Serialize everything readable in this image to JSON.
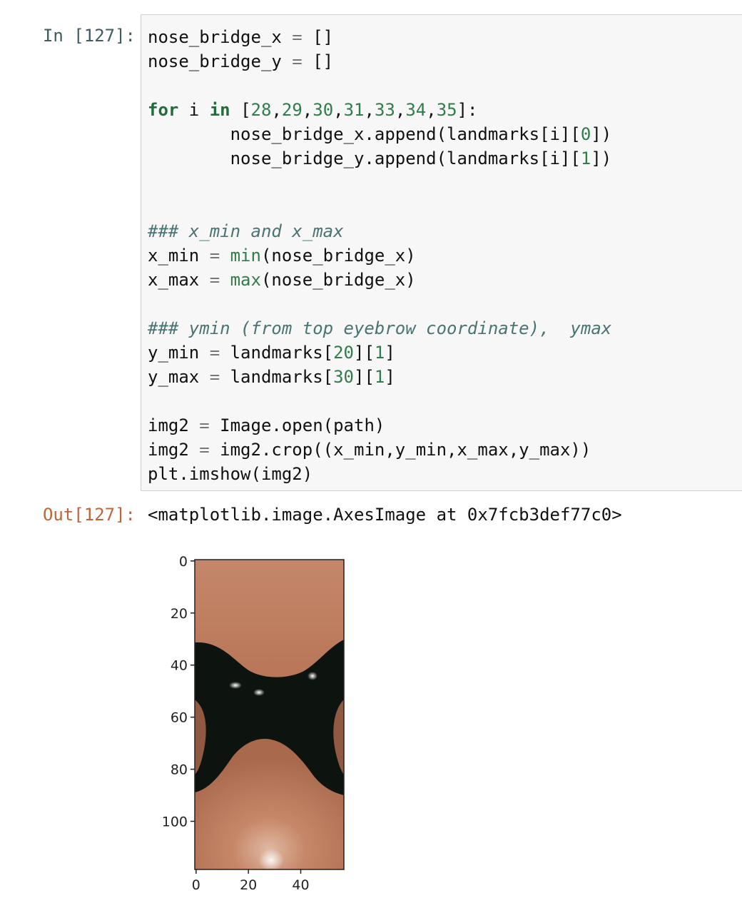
{
  "cell": {
    "in_prompt": "In [127]:",
    "out_prompt": "Out[127]:",
    "code_lines": [
      [
        [
          "nose_bridge_x ",
          ""
        ],
        [
          "=",
          "op"
        ],
        [
          " []",
          ""
        ]
      ],
      [
        [
          "nose_bridge_y ",
          ""
        ],
        [
          "=",
          "op"
        ],
        [
          " []",
          ""
        ]
      ],
      [],
      [
        [
          "for",
          "kw"
        ],
        [
          " i ",
          ""
        ],
        [
          "in",
          "kw"
        ],
        [
          " [",
          ""
        ],
        [
          "28",
          "num"
        ],
        [
          ",",
          ""
        ],
        [
          "29",
          "num"
        ],
        [
          ",",
          ""
        ],
        [
          "30",
          "num"
        ],
        [
          ",",
          ""
        ],
        [
          "31",
          "num"
        ],
        [
          ",",
          ""
        ],
        [
          "33",
          "num"
        ],
        [
          ",",
          ""
        ],
        [
          "34",
          "num"
        ],
        [
          ",",
          ""
        ],
        [
          "35",
          "num"
        ],
        [
          "]:",
          ""
        ]
      ],
      [
        [
          "        nose_bridge_x.append(landmarks[i][",
          ""
        ],
        [
          "0",
          "num"
        ],
        [
          "])",
          ""
        ]
      ],
      [
        [
          "        nose_bridge_y.append(landmarks[i][",
          ""
        ],
        [
          "1",
          "num"
        ],
        [
          "])",
          ""
        ]
      ],
      [],
      [],
      [
        [
          "### x_min and x_max",
          "cm"
        ]
      ],
      [
        [
          "x_min ",
          ""
        ],
        [
          "=",
          "op"
        ],
        [
          " ",
          ""
        ],
        [
          "min",
          "bi"
        ],
        [
          "(nose_bridge_x)",
          ""
        ]
      ],
      [
        [
          "x_max ",
          ""
        ],
        [
          "=",
          "op"
        ],
        [
          " ",
          ""
        ],
        [
          "max",
          "bi"
        ],
        [
          "(nose_bridge_x)",
          ""
        ]
      ],
      [],
      [
        [
          "### ymin (from top eyebrow coordinate),  ymax",
          "cm"
        ]
      ],
      [
        [
          "y_min ",
          ""
        ],
        [
          "=",
          "op"
        ],
        [
          " landmarks[",
          ""
        ],
        [
          "20",
          "num"
        ],
        [
          "][",
          ""
        ],
        [
          "1",
          "num"
        ],
        [
          "]",
          ""
        ]
      ],
      [
        [
          "y_max ",
          ""
        ],
        [
          "=",
          "op"
        ],
        [
          " landmarks[",
          ""
        ],
        [
          "30",
          "num"
        ],
        [
          "][",
          ""
        ],
        [
          "1",
          "num"
        ],
        [
          "]",
          ""
        ]
      ],
      [],
      [
        [
          "img2 ",
          ""
        ],
        [
          "=",
          "op"
        ],
        [
          " Image.open(path)",
          ""
        ]
      ],
      [
        [
          "img2 ",
          ""
        ],
        [
          "=",
          "op"
        ],
        [
          " img2.crop((x_min,y_min,x_max,y_max))",
          ""
        ]
      ],
      [
        [
          "plt.imshow(img2)",
          ""
        ]
      ]
    ],
    "output_text": "<matplotlib.image.AxesImage at 0x7fcb3def77c0>"
  },
  "plot": {
    "y_ticks": [
      "0",
      "20",
      "40",
      "60",
      "80",
      "100"
    ],
    "x_ticks": [
      "0",
      "20",
      "40"
    ],
    "image_extent": {
      "width": 57,
      "height": 119
    },
    "colors": {
      "skin": "#c4876a",
      "skin_dark": "#9c5e44",
      "dark": "#0d130f",
      "highlight": "#f1e6dc"
    }
  }
}
